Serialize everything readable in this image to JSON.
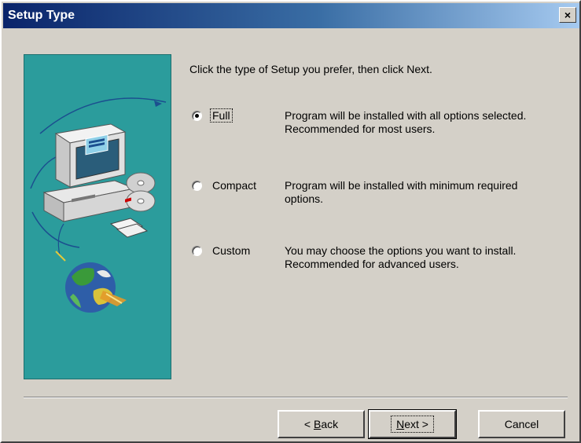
{
  "window": {
    "title": "Setup Type",
    "close_glyph": "×"
  },
  "prompt": "Click the type of Setup you prefer, then click Next.",
  "options": [
    {
      "label": "Full",
      "selected": true,
      "desc_line1": "Program will be installed with all options selected.",
      "desc_line2": "Recommended for most users."
    },
    {
      "label": "Compact",
      "selected": false,
      "desc_line1": "Program will be installed with minimum required",
      "desc_line2": "options."
    },
    {
      "label": "Custom",
      "selected": false,
      "desc_line1": "You may choose the options you want to install.",
      "desc_line2": "Recommended for advanced users."
    }
  ],
  "buttons": {
    "back_prefix": "< ",
    "back_hotkey": "B",
    "back_rest": "ack",
    "next_hotkey": "N",
    "next_rest": "ext >",
    "cancel": "Cancel"
  },
  "colors": {
    "titlebar_start": "#0a246a",
    "titlebar_end": "#a6caf0",
    "side_panel": "#2b9c9c",
    "dialog_bg": "#d4d0c8"
  },
  "icons": {
    "side_art": "computer-with-cds-and-globe",
    "close": "close-icon"
  }
}
